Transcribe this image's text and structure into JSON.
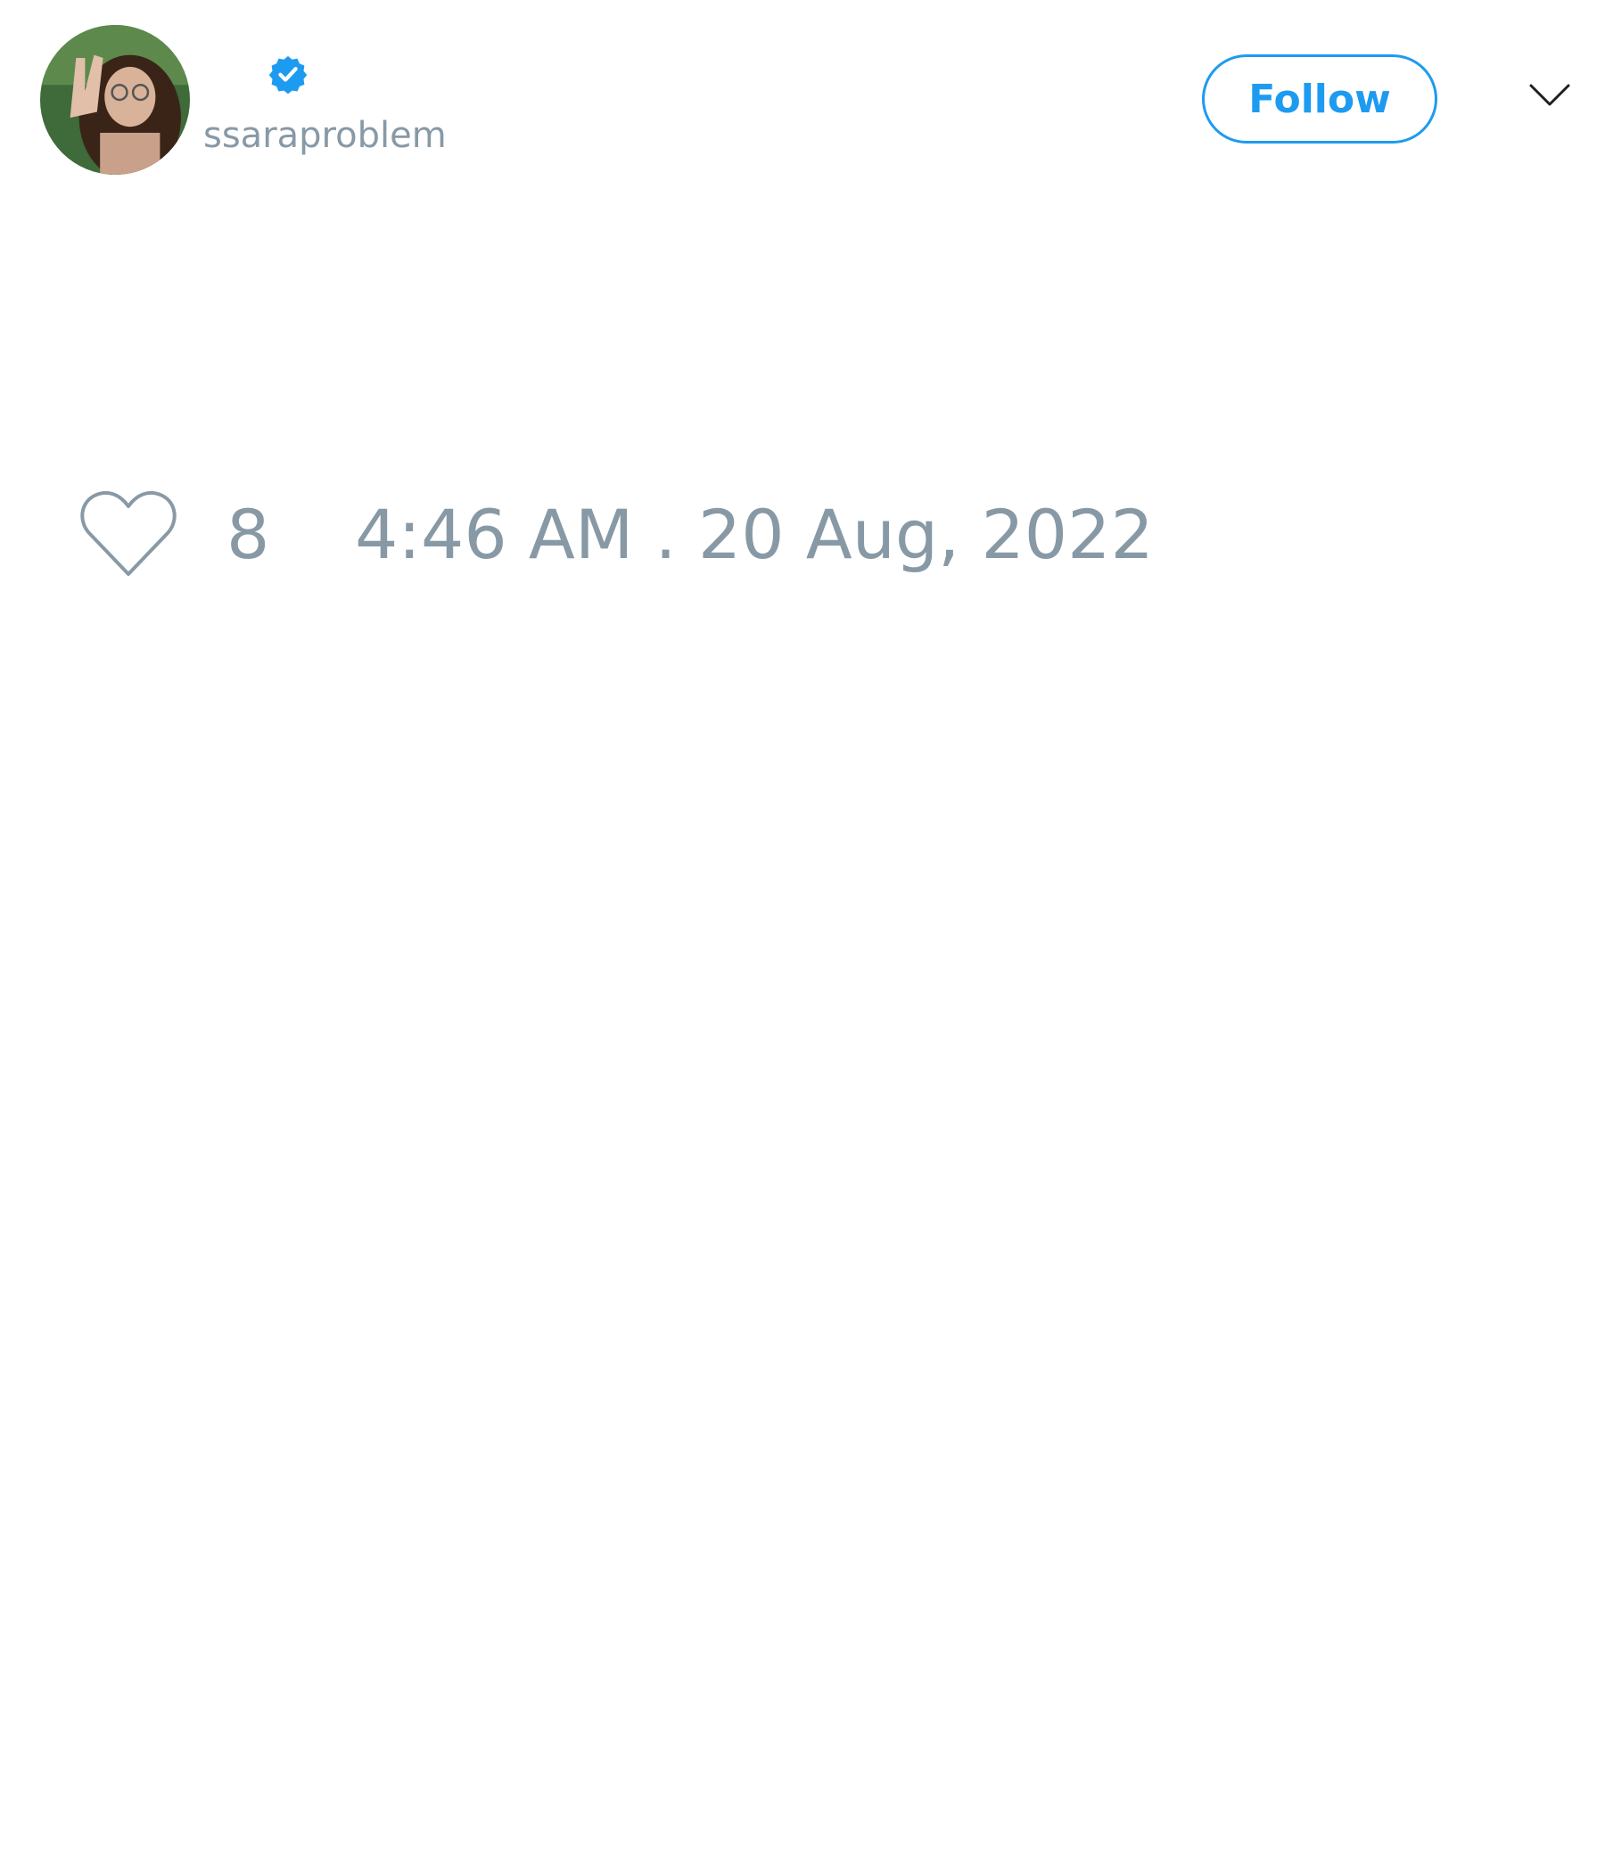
{
  "tweet": {
    "author": {
      "handle": "ssaraproblem",
      "verified": true
    },
    "follow_label": "Follow",
    "likes": "8",
    "timestamp": "4:46 AM . 20 Aug, 2022"
  },
  "icons": {
    "verified": "verified-badge-icon",
    "menu": "chevron-down-icon",
    "like": "heart-icon"
  },
  "colors": {
    "accent": "#1d9bf0",
    "muted_text": "#8899a6",
    "background": "#ffffff"
  }
}
